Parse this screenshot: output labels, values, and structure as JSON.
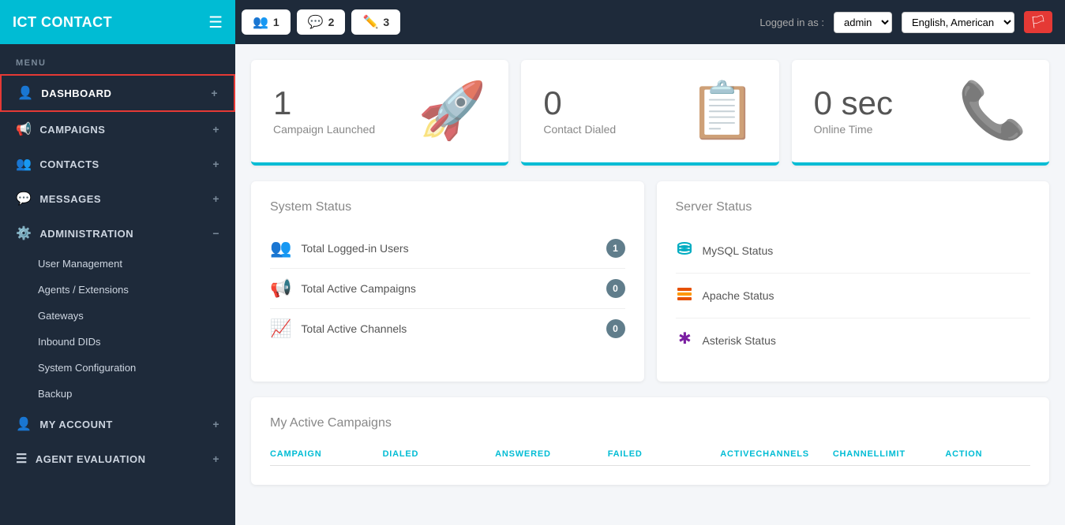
{
  "brand": {
    "title": "ICT CONTACT"
  },
  "header": {
    "tabs": [
      {
        "id": "tab1",
        "icon": "👥",
        "number": "1",
        "color": "green"
      },
      {
        "id": "tab2",
        "icon": "💬",
        "number": "2",
        "color": "teal"
      },
      {
        "id": "tab3",
        "icon": "✏️",
        "number": "3",
        "color": "red"
      }
    ],
    "logged_in_label": "Logged in as :",
    "user_value": "admin",
    "lang_value": "English, American",
    "flag_icon": "🏳"
  },
  "sidebar": {
    "menu_label": "MENU",
    "items": [
      {
        "id": "dashboard",
        "label": "DASHBOARD",
        "icon": "👤",
        "action": "+",
        "active": true
      },
      {
        "id": "campaigns",
        "label": "CAMPAIGNS",
        "icon": "📢",
        "action": "+"
      },
      {
        "id": "contacts",
        "label": "CONTACTS",
        "icon": "👥",
        "action": "+"
      },
      {
        "id": "messages",
        "label": "MESSAGES",
        "icon": "💬",
        "action": "+"
      },
      {
        "id": "administration",
        "label": "ADMINISTRATION",
        "icon": "⚙️",
        "action": "-"
      }
    ],
    "sub_items": [
      {
        "id": "user-management",
        "label": "User Management"
      },
      {
        "id": "agents-extensions",
        "label": "Agents / Extensions"
      },
      {
        "id": "gateways",
        "label": "Gateways"
      },
      {
        "id": "inbound-dids",
        "label": "Inbound DIDs"
      },
      {
        "id": "system-configuration",
        "label": "System Configuration"
      },
      {
        "id": "backup",
        "label": "Backup"
      }
    ],
    "bottom_items": [
      {
        "id": "my-account",
        "label": "MY ACCOUNT",
        "icon": "👤",
        "action": "+"
      },
      {
        "id": "agent-evaluation",
        "label": "AGENT EVALUATION",
        "icon": "☰",
        "action": "+"
      }
    ]
  },
  "stats": [
    {
      "number": "1",
      "label": "Campaign Launched",
      "icon": "🚀"
    },
    {
      "number": "0",
      "label": "Contact Dialed",
      "icon": "📋"
    },
    {
      "number": "0 sec",
      "label": "Online Time",
      "icon": "📞"
    }
  ],
  "system_status": {
    "title": "System Status",
    "rows": [
      {
        "label": "Total Logged-in Users",
        "count": "1",
        "icon": "👥"
      },
      {
        "label": "Total Active Campaigns",
        "count": "0",
        "icon": "📢"
      },
      {
        "label": "Total Active Channels",
        "count": "0",
        "icon": "📈"
      }
    ]
  },
  "server_status": {
    "title": "Server Status",
    "rows": [
      {
        "label": "MySQL Status",
        "icon_type": "mysql"
      },
      {
        "label": "Apache Status",
        "icon_type": "apache"
      },
      {
        "label": "Asterisk Status",
        "icon_type": "asterisk"
      }
    ]
  },
  "campaigns_section": {
    "title": "My Active Campaigns",
    "columns": [
      "CAMPAIGN",
      "DIALED",
      "ANSWERED",
      "FAILED",
      "ACTIVECHANNELS",
      "CHANNELLIMIT",
      "ACTION"
    ]
  }
}
